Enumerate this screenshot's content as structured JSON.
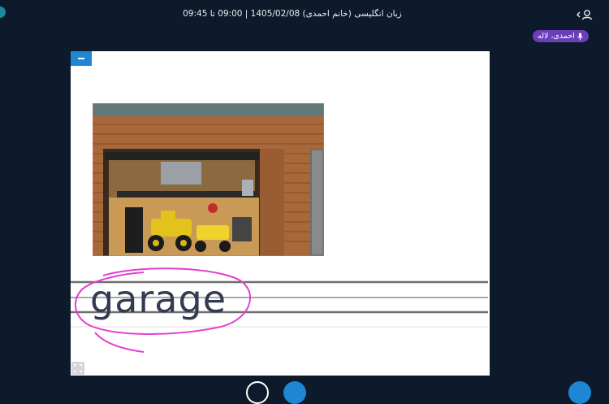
{
  "header": {
    "title": "زبان انگلیسی (خانم احمدی) 1405/02/08 | 09:00 تا 09:45"
  },
  "presenter": {
    "name": "احمدی، لاله"
  },
  "board": {
    "word": "garage",
    "annotation_color": "#e33fcf",
    "image_subject": "garage-with-quad-bikes"
  },
  "colors": {
    "background": "#0c1a2b",
    "accent_blue": "#1f86d6",
    "presenter_badge": "#6a3fb8"
  }
}
